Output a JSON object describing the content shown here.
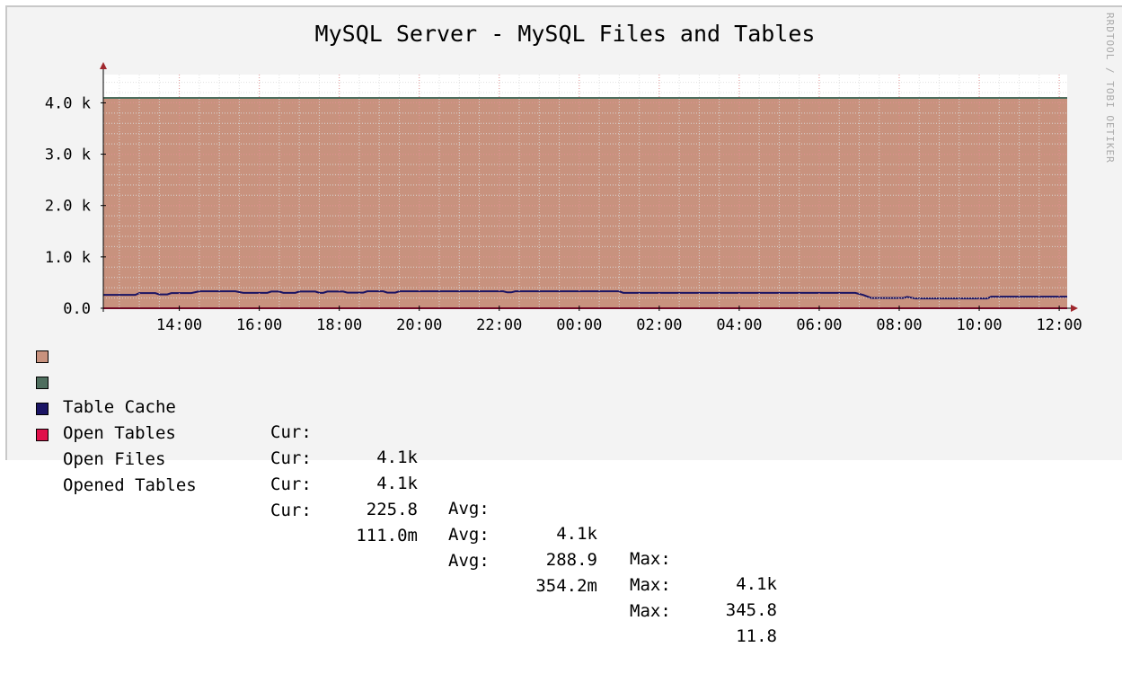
{
  "title": "MySQL Server - MySQL Files and Tables",
  "watermark": "RRDTOOL / TOBI OETIKER",
  "chart_data": {
    "type": "area",
    "title": "MySQL Server - MySQL Files and Tables",
    "xlabel": "",
    "ylabel": "",
    "y_ticks": [
      "0.0",
      "1.0 k",
      "2.0 k",
      "3.0 k",
      "4.0 k"
    ],
    "y_tick_values": [
      0,
      1000,
      2000,
      3000,
      4000
    ],
    "x_ticks": [
      "14:00",
      "16:00",
      "18:00",
      "20:00",
      "22:00",
      "00:00",
      "02:00",
      "04:00",
      "06:00",
      "08:00",
      "10:00",
      "12:00"
    ],
    "x_tick_hours": [
      14,
      16,
      18,
      20,
      22,
      24,
      26,
      28,
      30,
      32,
      34,
      36
    ],
    "xlim_hours": [
      12.1,
      36.2
    ],
    "ylim": [
      0,
      4550
    ],
    "grid": true,
    "legend_position": "bottom",
    "series": [
      {
        "name": "Table Cache",
        "color": "#c8927e",
        "style": "area",
        "points": [
          [
            12.1,
            4096
          ],
          [
            36.2,
            4096
          ]
        ]
      },
      {
        "name": "Open Tables",
        "color": "#4e6e5e",
        "style": "line",
        "points": [
          [
            12.1,
            4096
          ],
          [
            36.2,
            4096
          ]
        ]
      },
      {
        "name": "Open Files",
        "color": "#1a1464",
        "style": "line",
        "points": [
          [
            12.1,
            260
          ],
          [
            12.9,
            260
          ],
          [
            13.0,
            295
          ],
          [
            13.4,
            295
          ],
          [
            13.5,
            270
          ],
          [
            13.7,
            270
          ],
          [
            13.8,
            295
          ],
          [
            14.3,
            295
          ],
          [
            14.5,
            330
          ],
          [
            15.4,
            330
          ],
          [
            15.6,
            300
          ],
          [
            16.2,
            300
          ],
          [
            16.3,
            325
          ],
          [
            16.5,
            325
          ],
          [
            16.6,
            300
          ],
          [
            16.9,
            300
          ],
          [
            17.0,
            325
          ],
          [
            17.4,
            325
          ],
          [
            17.5,
            300
          ],
          [
            17.6,
            300
          ],
          [
            17.7,
            325
          ],
          [
            18.1,
            325
          ],
          [
            18.2,
            305
          ],
          [
            18.6,
            305
          ],
          [
            18.7,
            330
          ],
          [
            19.1,
            330
          ],
          [
            19.2,
            305
          ],
          [
            19.4,
            305
          ],
          [
            19.5,
            330
          ],
          [
            22.1,
            330
          ],
          [
            22.2,
            310
          ],
          [
            22.3,
            310
          ],
          [
            22.4,
            330
          ],
          [
            25.0,
            330
          ],
          [
            25.1,
            300
          ],
          [
            30.9,
            300
          ],
          [
            31.1,
            260
          ],
          [
            31.3,
            200
          ],
          [
            32.1,
            200
          ],
          [
            32.2,
            220
          ],
          [
            32.4,
            190
          ],
          [
            34.2,
            190
          ],
          [
            34.3,
            225
          ],
          [
            36.2,
            225
          ]
        ]
      },
      {
        "name": "Opened Tables",
        "color": "#e0104a",
        "style": "line",
        "points": [
          [
            12.1,
            0.354
          ],
          [
            36.2,
            0.111
          ]
        ]
      }
    ]
  },
  "legend": [
    {
      "name": "Table Cache",
      "color": "#c8927e",
      "cur_label": "Cur:",
      "cur": "4.1k",
      "avg_label": "",
      "avg": "",
      "max_label": "",
      "max": ""
    },
    {
      "name": "Open Tables",
      "color": "#4e6e5e",
      "cur_label": "Cur:",
      "cur": "4.1k",
      "avg_label": "Avg:",
      "avg": "4.1k",
      "max_label": "Max:",
      "max": "4.1k"
    },
    {
      "name": "Open Files",
      "color": "#1a1464",
      "cur_label": "Cur:",
      "cur": "225.8",
      "avg_label": "Avg:",
      "avg": "288.9",
      "max_label": "Max:",
      "max": "345.8"
    },
    {
      "name": "Opened Tables",
      "color": "#e0104a",
      "cur_label": "Cur:",
      "cur": "111.0m",
      "avg_label": "Avg:",
      "avg": "354.2m",
      "max_label": "Max:",
      "max": "11.8"
    }
  ]
}
